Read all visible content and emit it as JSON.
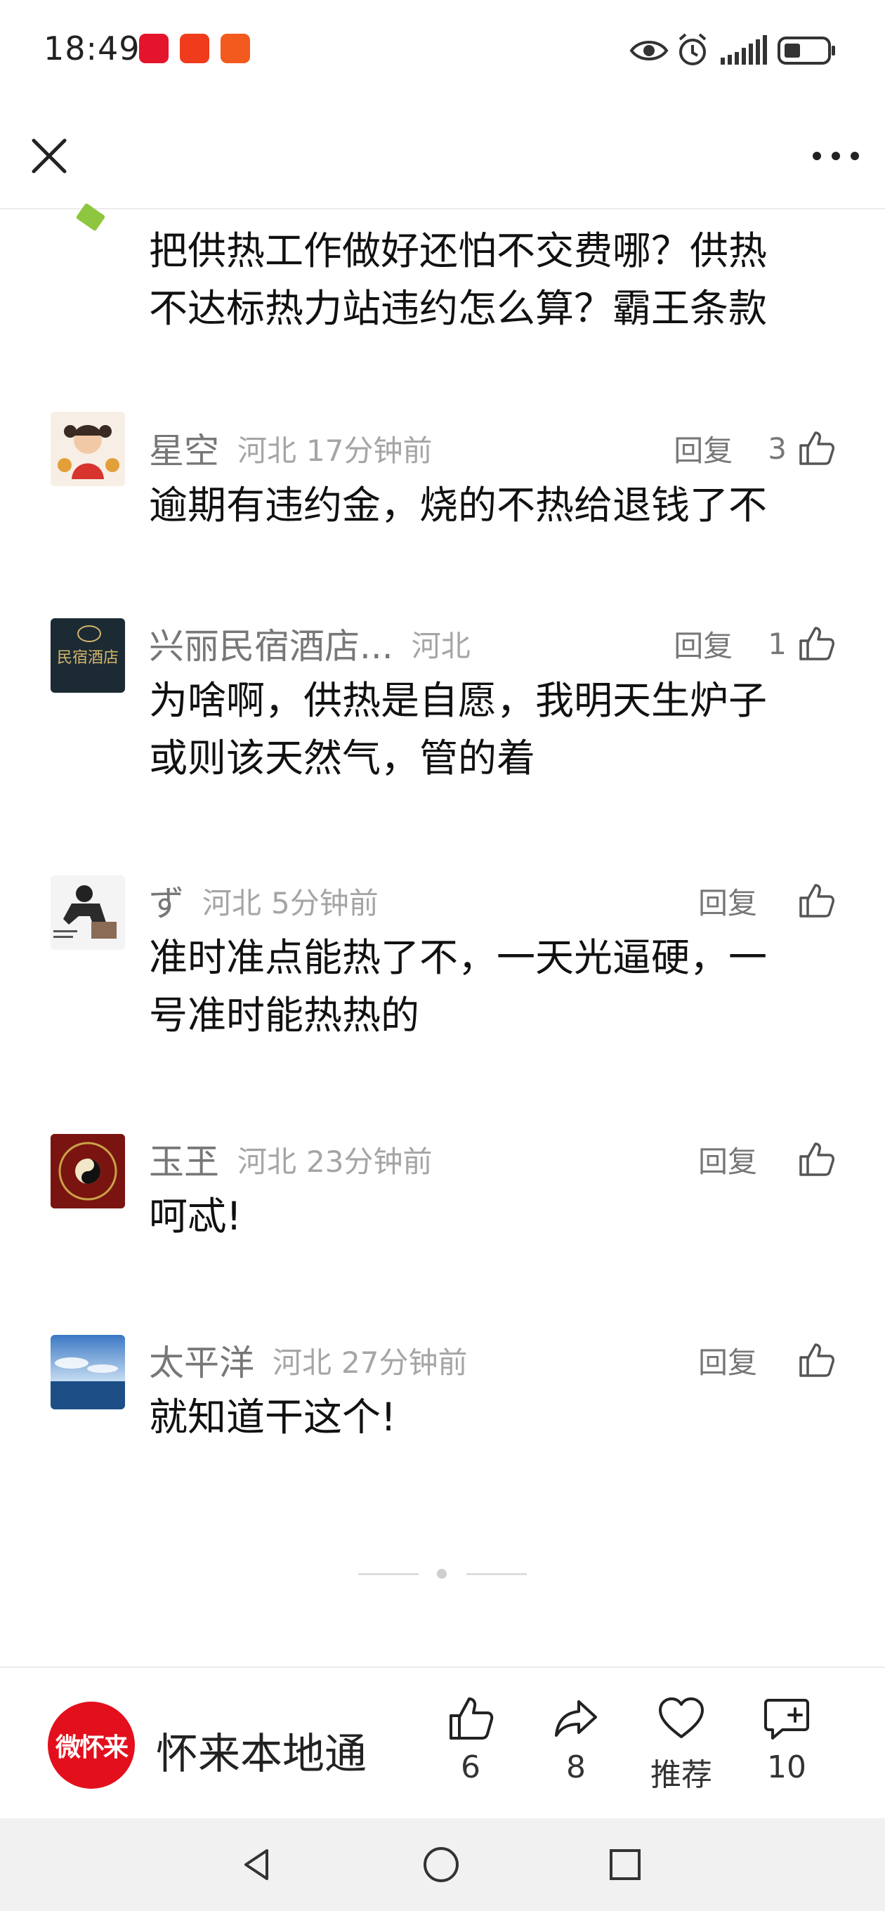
{
  "status_bar": {
    "time": "18:49"
  },
  "comments": [
    {
      "name": "",
      "location": "",
      "time": "",
      "likes": "",
      "reply_label": "",
      "lines": [
        "把供热工作做好还怕不交费哪？供热",
        "不达标热力站违约怎么算？霸王条款"
      ]
    },
    {
      "name": "星空",
      "location": "河北",
      "time": "17分钟前",
      "likes": "3",
      "reply_label": "回复",
      "lines": [
        "逾期有违约金，烧的不热给退钱了不"
      ]
    },
    {
      "name": "兴丽民宿酒店...",
      "location": "河北",
      "time": "",
      "likes": "1",
      "reply_label": "回复",
      "avatar_text": "民宿酒店",
      "lines": [
        "为啥啊，供热是自愿，我明天生炉子",
        "或则该天然气，管的着"
      ]
    },
    {
      "name": "ず",
      "location": "河北",
      "time": "5分钟前",
      "likes": "",
      "reply_label": "回复",
      "lines": [
        "准时准点能热了不，一天光逼硬，一",
        "号准时能热热的"
      ]
    },
    {
      "name": "玉玊",
      "location": "河北",
      "time": "23分钟前",
      "likes": "",
      "reply_label": "回复",
      "lines": [
        "呵忒!"
      ]
    },
    {
      "name": "太平洋",
      "location": "河北",
      "time": "27分钟前",
      "likes": "",
      "reply_label": "回复",
      "lines": [
        "就知道干这个!"
      ]
    }
  ],
  "bottom_bar": {
    "brand_logo_text": "微怀来",
    "brand_name": "怀来本地通",
    "like_count": "6",
    "share_count": "8",
    "recommend_label": "推荐",
    "comment_count": "10"
  },
  "colors": {
    "accent_red": "#e30f1c",
    "text": "#111111",
    "meta": "#a5a5a5"
  }
}
